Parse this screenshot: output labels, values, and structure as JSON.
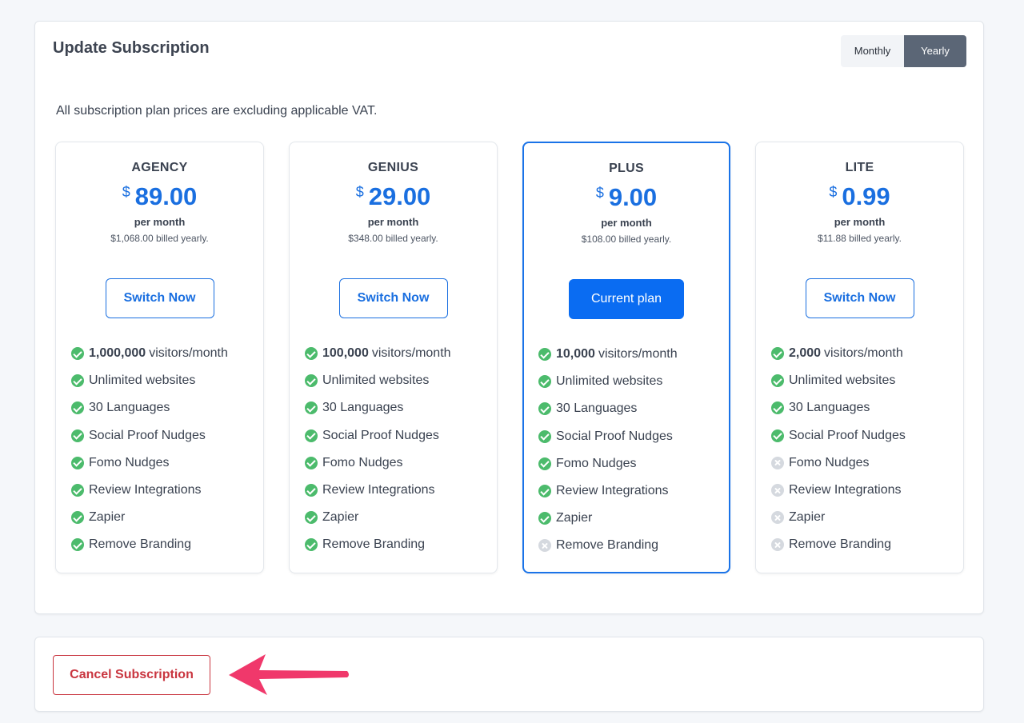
{
  "header": {
    "title": "Update Subscription",
    "toggle": {
      "monthly": "Monthly",
      "yearly": "Yearly",
      "selected": "Yearly"
    }
  },
  "vat_note": "All subscription plan prices are excluding applicable VAT.",
  "plans": [
    {
      "name": "AGENCY",
      "currency": "$",
      "price": "89.00",
      "period": "per month",
      "billed": "$1,068.00 billed yearly.",
      "button": "Switch Now",
      "current": false,
      "features": [
        {
          "bold": "1,000,000",
          "text": "visitors/month",
          "included": true
        },
        {
          "bold": "",
          "text": "Unlimited websites",
          "included": true
        },
        {
          "bold": "",
          "text": "30 Languages",
          "included": true
        },
        {
          "bold": "",
          "text": "Social Proof Nudges",
          "included": true
        },
        {
          "bold": "",
          "text": "Fomo Nudges",
          "included": true
        },
        {
          "bold": "",
          "text": "Review Integrations",
          "included": true
        },
        {
          "bold": "",
          "text": "Zapier",
          "included": true
        },
        {
          "bold": "",
          "text": "Remove Branding",
          "included": true
        }
      ]
    },
    {
      "name": "GENIUS",
      "currency": "$",
      "price": "29.00",
      "period": "per month",
      "billed": "$348.00 billed yearly.",
      "button": "Switch Now",
      "current": false,
      "features": [
        {
          "bold": "100,000",
          "text": "visitors/month",
          "included": true
        },
        {
          "bold": "",
          "text": "Unlimited websites",
          "included": true
        },
        {
          "bold": "",
          "text": "30 Languages",
          "included": true
        },
        {
          "bold": "",
          "text": "Social Proof Nudges",
          "included": true
        },
        {
          "bold": "",
          "text": "Fomo Nudges",
          "included": true
        },
        {
          "bold": "",
          "text": "Review Integrations",
          "included": true
        },
        {
          "bold": "",
          "text": "Zapier",
          "included": true
        },
        {
          "bold": "",
          "text": "Remove Branding",
          "included": true
        }
      ]
    },
    {
      "name": "PLUS",
      "currency": "$",
      "price": "9.00",
      "period": "per month",
      "billed": "$108.00 billed yearly.",
      "button": "Current plan",
      "current": true,
      "features": [
        {
          "bold": "10,000",
          "text": "visitors/month",
          "included": true
        },
        {
          "bold": "",
          "text": "Unlimited websites",
          "included": true
        },
        {
          "bold": "",
          "text": "30 Languages",
          "included": true
        },
        {
          "bold": "",
          "text": "Social Proof Nudges",
          "included": true
        },
        {
          "bold": "",
          "text": "Fomo Nudges",
          "included": true
        },
        {
          "bold": "",
          "text": "Review Integrations",
          "included": true
        },
        {
          "bold": "",
          "text": "Zapier",
          "included": true
        },
        {
          "bold": "",
          "text": "Remove Branding",
          "included": false
        }
      ]
    },
    {
      "name": "LITE",
      "currency": "$",
      "price": "0.99",
      "period": "per month",
      "billed": "$11.88 billed yearly.",
      "button": "Switch Now",
      "current": false,
      "features": [
        {
          "bold": "2,000",
          "text": "visitors/month",
          "included": true
        },
        {
          "bold": "",
          "text": "Unlimited websites",
          "included": true
        },
        {
          "bold": "",
          "text": "30 Languages",
          "included": true
        },
        {
          "bold": "",
          "text": "Social Proof Nudges",
          "included": true
        },
        {
          "bold": "",
          "text": "Fomo Nudges",
          "included": false
        },
        {
          "bold": "",
          "text": "Review Integrations",
          "included": false
        },
        {
          "bold": "",
          "text": "Zapier",
          "included": false
        },
        {
          "bold": "",
          "text": "Remove Branding",
          "included": false
        }
      ]
    }
  ],
  "cancel": {
    "label": "Cancel Subscription"
  },
  "annotation": {
    "icon": "arrow-left-icon",
    "color": "#f0386b"
  },
  "colors": {
    "accent": "#0a6cf2",
    "check": "#4cbb6c",
    "cross": "#d5d9df",
    "danger": "#c9353f",
    "toggle_active": "#5b6676"
  }
}
